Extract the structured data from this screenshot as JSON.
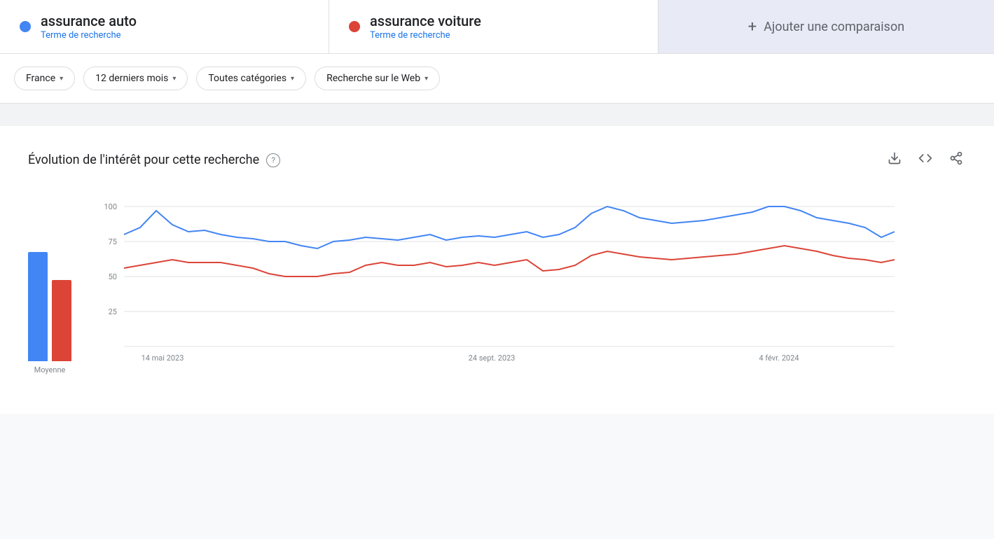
{
  "search_terms": [
    {
      "id": "term1",
      "label": "assurance auto",
      "subtitle": "Terme de recherche",
      "dot_color": "#4285f4"
    },
    {
      "id": "term2",
      "label": "assurance voiture",
      "subtitle": "Terme de recherche",
      "dot_color": "#db4437"
    }
  ],
  "add_comparison": {
    "label": "Ajouter une comparaison"
  },
  "filters": [
    {
      "id": "country",
      "label": "France"
    },
    {
      "id": "period",
      "label": "12 derniers mois"
    },
    {
      "id": "categories",
      "label": "Toutes catégories"
    },
    {
      "id": "search_type",
      "label": "Recherche sur le Web"
    }
  ],
  "chart_section": {
    "title": "Évolution de l'intérêt pour cette recherche",
    "help_text": "?",
    "actions": {
      "download": "⬇",
      "embed": "<>",
      "share": "⤢"
    }
  },
  "bar_chart": {
    "label": "Moyenne",
    "bar1_color": "#4285f4",
    "bar2_color": "#db4437",
    "bar1_height_pct": 78,
    "bar2_height_pct": 58
  },
  "x_axis_labels": [
    "14 mai 2023",
    "24 sept. 2023",
    "4 févr. 2024"
  ],
  "y_axis_labels": [
    "100",
    "75",
    "50",
    "25"
  ],
  "chart_data": {
    "blue_line": [
      80,
      85,
      97,
      87,
      82,
      83,
      80,
      78,
      77,
      75,
      75,
      72,
      70,
      75,
      76,
      78,
      77,
      76,
      78,
      80,
      76,
      78,
      79,
      78,
      80,
      82,
      78,
      80,
      85,
      95,
      100,
      97,
      92,
      90,
      88,
      89,
      90,
      92,
      94,
      96,
      98,
      100,
      97,
      92,
      90,
      88,
      85,
      80,
      78
    ],
    "red_line": [
      56,
      58,
      60,
      62,
      60,
      60,
      60,
      58,
      56,
      52,
      50,
      50,
      50,
      52,
      53,
      58,
      60,
      58,
      58,
      60,
      57,
      58,
      60,
      58,
      60,
      62,
      54,
      55,
      58,
      65,
      68,
      66,
      64,
      63,
      62,
      63,
      64,
      65,
      66,
      68,
      70,
      72,
      70,
      68,
      65,
      63,
      62,
      60,
      62
    ]
  }
}
